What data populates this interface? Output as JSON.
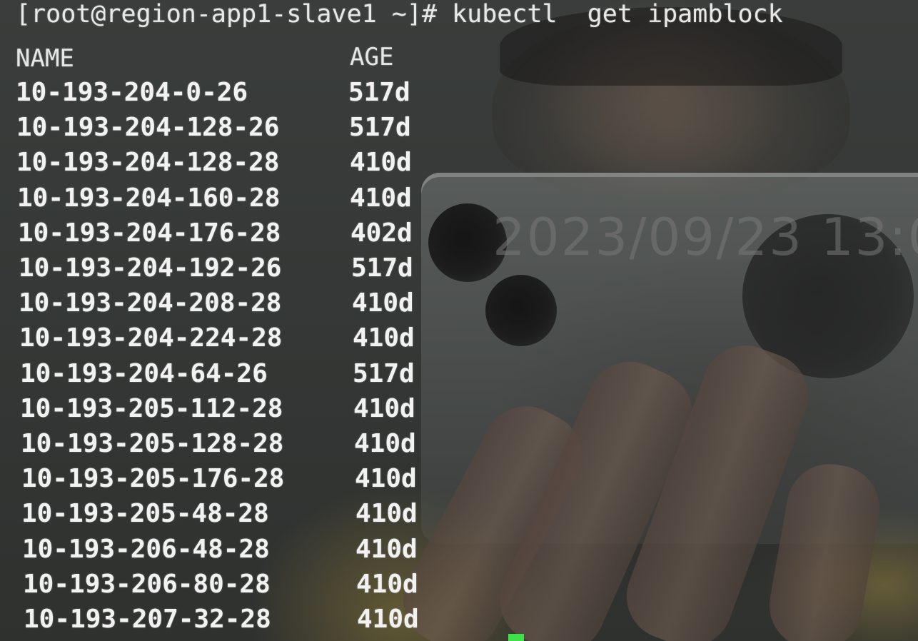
{
  "terminal": {
    "prompt": "[root@region-app1-slave1 ~]#",
    "command": "kubectl  get ipamblock",
    "headers": {
      "name": "NAME",
      "age": "AGE"
    },
    "rows": [
      {
        "name": "10-193-204-0-26",
        "age": "517d"
      },
      {
        "name": "10-193-204-128-26",
        "age": "517d"
      },
      {
        "name": "10-193-204-128-28",
        "age": "410d"
      },
      {
        "name": "10-193-204-160-28",
        "age": "410d"
      },
      {
        "name": "10-193-204-176-28",
        "age": "402d"
      },
      {
        "name": "10-193-204-192-26",
        "age": "517d"
      },
      {
        "name": "10-193-204-208-28",
        "age": "410d"
      },
      {
        "name": "10-193-204-224-28",
        "age": "410d"
      },
      {
        "name": "10-193-204-64-26",
        "age": "517d"
      },
      {
        "name": "10-193-205-112-28",
        "age": "410d"
      },
      {
        "name": "10-193-205-128-28",
        "age": "410d"
      },
      {
        "name": "10-193-205-176-28",
        "age": "410d"
      },
      {
        "name": "10-193-205-48-28",
        "age": "410d"
      },
      {
        "name": "10-193-206-48-28",
        "age": "410d"
      },
      {
        "name": "10-193-206-80-28",
        "age": "410d"
      },
      {
        "name": "10-193-207-32-28",
        "age": "410d"
      }
    ]
  },
  "reflection": {
    "date_text": "2023/09/23 13:0"
  },
  "colors": {
    "text": "#f2f2f2",
    "cursor": "#3fe04a",
    "background": "#353836"
  }
}
